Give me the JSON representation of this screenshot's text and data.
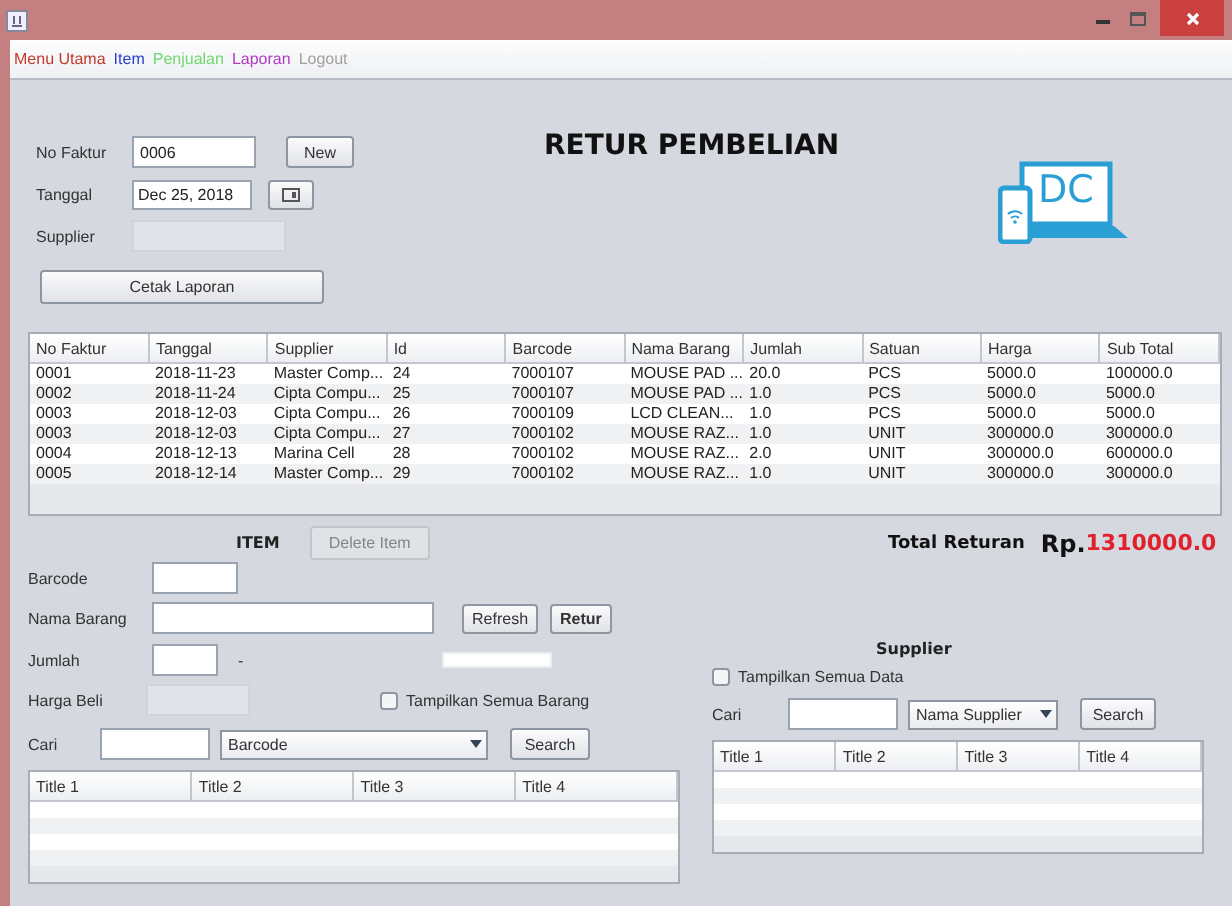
{
  "menu": [
    {
      "label": "Menu Utama",
      "color": "#c0392b"
    },
    {
      "label": "Item",
      "color": "#2a3fd0"
    },
    {
      "label": "Penjualan",
      "color": "#6fd86f"
    },
    {
      "label": "Laporan",
      "color": "#b03bc0"
    },
    {
      "label": "Logout",
      "color": "#a0a0a0"
    }
  ],
  "invoice": {
    "no_faktur_label": "No Faktur",
    "no_faktur": "0006",
    "new_button": "New",
    "tanggal_label": "Tanggal",
    "tanggal": "Dec 25, 2018",
    "supplier_label": "Supplier",
    "supplier_disabled": true,
    "print_button": "Cetak Laporan"
  },
  "title": "RETUR PEMBELIAN",
  "logo": {
    "text": "DC"
  },
  "returns_table": {
    "columns": [
      "No Faktur",
      "Tanggal",
      "Supplier",
      "Id",
      "Barcode",
      "Nama Barang",
      "Jumlah",
      "Satuan",
      "Harga",
      "Sub Total"
    ],
    "rows": [
      [
        "0001",
        "2018-11-23",
        "Master Comp...",
        "24",
        "7000107",
        "MOUSE PAD ...",
        "20.0",
        "PCS",
        "5000.0",
        "100000.0"
      ],
      [
        "0002",
        "2018-11-24",
        "Cipta Compu...",
        "25",
        "7000107",
        "MOUSE PAD ...",
        "1.0",
        "PCS",
        "5000.0",
        "5000.0"
      ],
      [
        "0003",
        "2018-12-03",
        "Cipta Compu...",
        "26",
        "7000109",
        "LCD CLEAN...",
        "1.0",
        "PCS",
        "5000.0",
        "5000.0"
      ],
      [
        "0003",
        "2018-12-03",
        "Cipta Compu...",
        "27",
        "7000102",
        "MOUSE RAZ...",
        "1.0",
        "UNIT",
        "300000.0",
        "300000.0"
      ],
      [
        "0004",
        "2018-12-13",
        "Marina Cell",
        "28",
        "7000102",
        "MOUSE RAZ...",
        "2.0",
        "UNIT",
        "300000.0",
        "600000.0"
      ],
      [
        "0005",
        "2018-12-14",
        "Master Comp...",
        "29",
        "7000102",
        "MOUSE RAZ...",
        "1.0",
        "UNIT",
        "300000.0",
        "300000.0"
      ]
    ]
  },
  "item_panel": {
    "heading": "ITEM",
    "delete_button": {
      "label": "Delete Item",
      "disabled": true
    },
    "barcode_label": "Barcode",
    "nama_label": "Nama Barang",
    "jumlah_label": "Jumlah",
    "jumlah_dash": "-",
    "harga_label": "Harga Beli",
    "harga_disabled": true,
    "refresh_button": "Refresh",
    "retur_button": "Retur",
    "show_all": {
      "label": "Tampilkan Semua Barang",
      "checked": false
    },
    "search_label": "Cari",
    "search_by": "Barcode",
    "search_button": "Search",
    "table_columns": [
      "Title 1",
      "Title 2",
      "Title 3",
      "Title 4"
    ]
  },
  "total": {
    "label": "Total Returan",
    "currency": "Rp.",
    "value": "1310000.0"
  },
  "supplier_panel": {
    "heading": "Supplier",
    "show_all": {
      "label": "Tampilkan Semua Data",
      "checked": false
    },
    "search_label": "Cari",
    "search_by": "Nama Supplier",
    "search_button": "Search",
    "table_columns": [
      "Title 1",
      "Title 2",
      "Title 3",
      "Title 4"
    ]
  }
}
